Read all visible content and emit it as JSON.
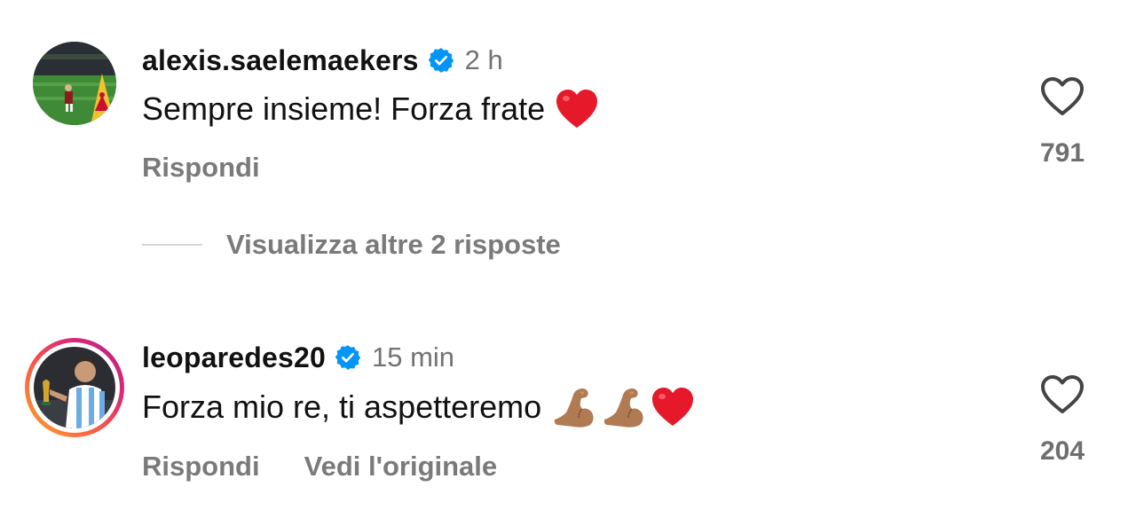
{
  "comments": [
    {
      "username": "alexis.saelemaekers",
      "verified": true,
      "time": "2 h",
      "text": "Sempre insieme! Forza frate",
      "emojis": [
        "red-heart"
      ],
      "actions": {
        "reply": "Rispondi"
      },
      "likes": "791",
      "view_replies": "Visualizza altre 2 risposte"
    },
    {
      "username": "leoparedes20",
      "verified": true,
      "time": "15 min",
      "text": "Forza mio re, ti aspetteremo",
      "emojis": [
        "flexed-biceps-medium-skin",
        "flexed-biceps-medium-skin",
        "red-heart"
      ],
      "actions": {
        "reply": "Rispondi",
        "see_original": "Vedi l'originale"
      },
      "likes": "204",
      "has_story_ring": true
    }
  ],
  "colors": {
    "verified_blue": "#0095f6",
    "secondary_text": "#737373",
    "primary_text": "#111111"
  }
}
